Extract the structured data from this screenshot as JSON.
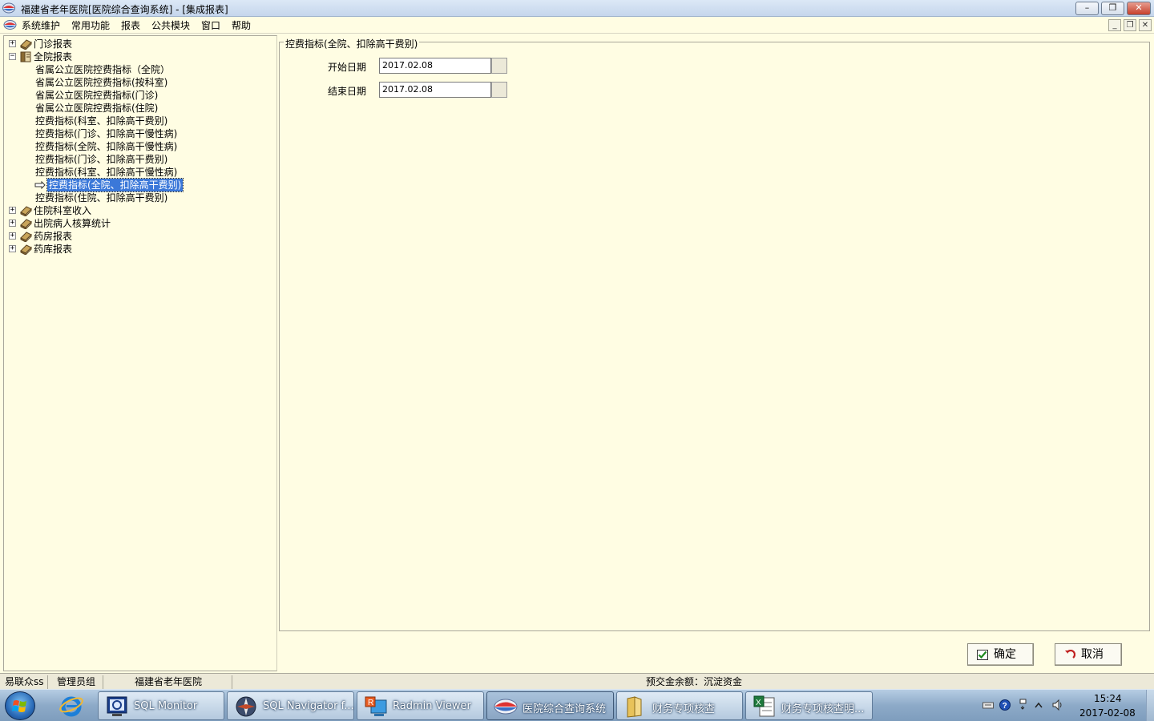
{
  "window": {
    "title": "福建省老年医院[医院综合查询系统] - [集成报表]"
  },
  "menu": {
    "items": [
      "系统维护",
      "常用功能",
      "报表",
      "公共模块",
      "窗口",
      "帮助"
    ]
  },
  "tree": {
    "groups": [
      {
        "label": "门诊报表",
        "expander": "+"
      },
      {
        "label": "全院报表",
        "expander": "−",
        "children": [
          "省属公立医院控费指标（全院）",
          "省属公立医院控费指标(按科室)",
          "省属公立医院控费指标(门诊)",
          "省属公立医院控费指标(住院)",
          "控费指标(科室、扣除高干费别)",
          "控费指标(门诊、扣除高干慢性病)",
          "控费指标(全院、扣除高干慢性病)",
          "控费指标(门诊、扣除高干费别)",
          "控费指标(科室、扣除高干慢性病)",
          "控费指标(全院、扣除高干费别)",
          "控费指标(住院、扣除高干费别)"
        ],
        "selected_index": 9
      },
      {
        "label": "住院科室收入",
        "expander": "+"
      },
      {
        "label": "出院病人核算统计",
        "expander": "+"
      },
      {
        "label": "药房报表",
        "expander": "+"
      },
      {
        "label": "药库报表",
        "expander": "+"
      }
    ]
  },
  "form": {
    "legend": "控费指标(全院、扣除高干费别)",
    "start_date_label": "开始日期",
    "start_date_value": "2017.02.08",
    "end_date_label": "结束日期",
    "end_date_value": "2017.02.08",
    "ok_label": "确定",
    "cancel_label": "取消"
  },
  "status": {
    "user": "易联众ss",
    "group": "管理员组",
    "hospital": "福建省老年医院",
    "message": "预交金余额：沉淀资金"
  },
  "taskbar": {
    "tasks": [
      {
        "label": "SQL Monitor",
        "icon": "sql-monitor-icon"
      },
      {
        "label": "SQL Navigator f...",
        "icon": "sql-navigator-icon"
      },
      {
        "label": "Radmin Viewer",
        "icon": "radmin-icon"
      },
      {
        "label": "医院综合查询系统",
        "icon": "hospital-query-icon",
        "active": true
      },
      {
        "label": "财务专项核查",
        "icon": "folder-icon"
      },
      {
        "label": "财务专项核查明...",
        "icon": "excel-icon"
      }
    ],
    "clock_time": "15:24",
    "clock_date": "2017-02-08"
  },
  "colors": {
    "panel_background": "#FFFDE3",
    "selection": "#3B78D9",
    "taskbar": "#8DAAC8"
  }
}
